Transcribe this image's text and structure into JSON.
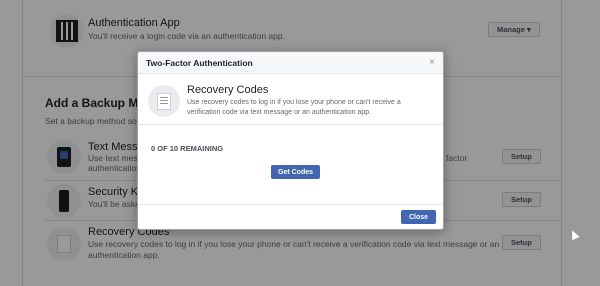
{
  "background": {
    "auth_app": {
      "title": "Authentication App",
      "subtitle": "You'll receive a login code via an authentication app.",
      "button": "Manage ▾"
    },
    "backup": {
      "heading": "Add a Backup Meth",
      "subheading": "Set a backup method so yo"
    },
    "text_message": {
      "title": "Text Messag",
      "line1": "Use text messag",
      "line1_right": "factor",
      "line2": "authentication",
      "button": "Setup"
    },
    "security_key": {
      "title": "Security Ke",
      "subtitle": "You'll be aske",
      "button": "Setup"
    },
    "recovery_codes": {
      "title": "Recovery Codes",
      "line1": "Use recovery codes to log in if you lose your phone or can't receive a verification code via text message or an",
      "line2": "authentication app.",
      "button": "Setup"
    }
  },
  "modal": {
    "title": "Two-Factor Authentication",
    "close_glyph": "×",
    "card_title": "Recovery Codes",
    "card_desc": "Use recovery codes to log in if you lose your phone or can't receive a verification code via text message or an authentication app.",
    "remaining": "0 OF 10 REMAINING",
    "get_codes": "Get Codes",
    "close_button": "Close"
  },
  "colors": {
    "accent": "#4267b2",
    "overlay": "rgba(0,0,0,0.4)"
  },
  "icons": {
    "auth_app": "qr-code-icon",
    "text_message": "phone-icon",
    "security_key": "security-key-icon",
    "recovery": "document-icon"
  }
}
